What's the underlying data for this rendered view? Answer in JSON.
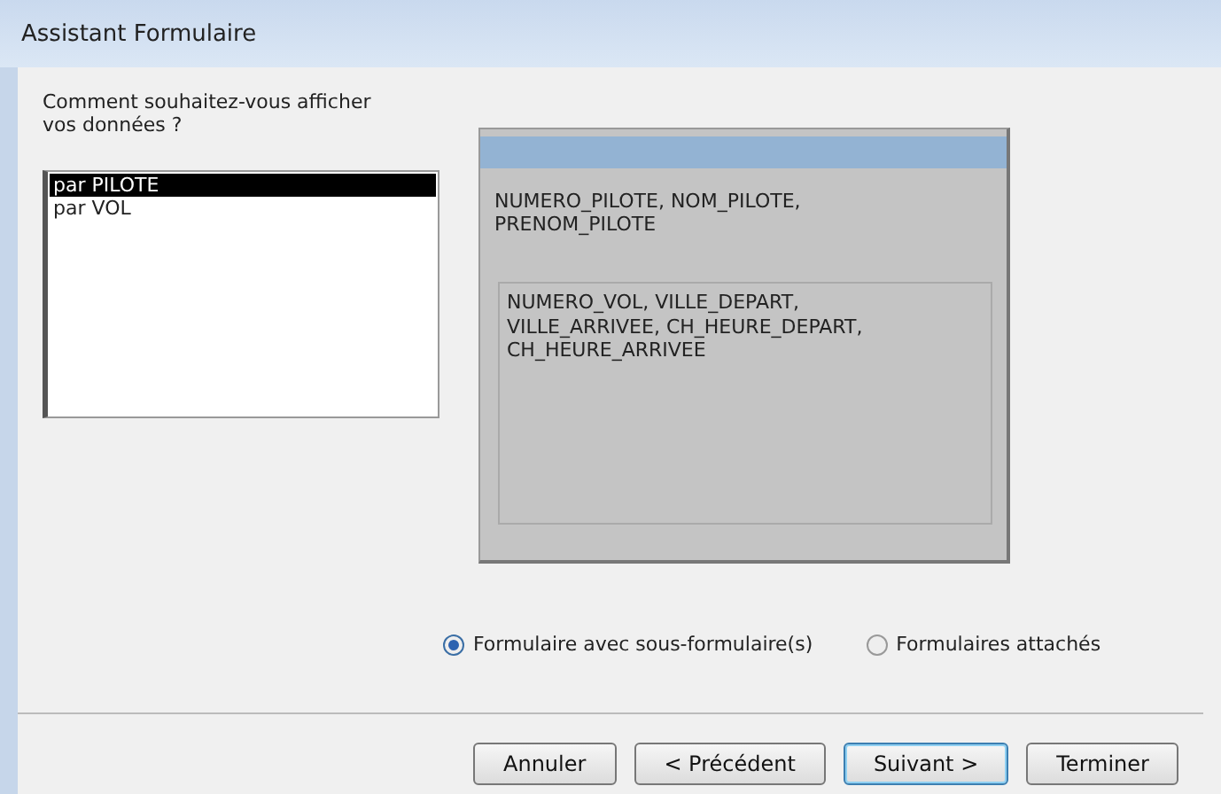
{
  "window": {
    "title": "Assistant Formulaire"
  },
  "prompt": "Comment souhaitez-vous afficher vos données ?",
  "views": [
    {
      "label": "par PILOTE",
      "selected": true
    },
    {
      "label": "par VOL",
      "selected": false
    }
  ],
  "preview": {
    "main_fields": "NUMERO_PILOTE, NOM_PILOTE, PRENOM_PILOTE",
    "sub_fields": "NUMERO_VOL, VILLE_DEPART, VILLE_ARRIVEE, CH_HEURE_DEPART, CH_HEURE_ARRIVEE"
  },
  "options": [
    {
      "label": "Formulaire avec sous-formulaire(s)",
      "selected": true
    },
    {
      "label": "Formulaires attachés",
      "selected": false
    }
  ],
  "buttons": [
    {
      "label": "Annuler",
      "default": false
    },
    {
      "label": "< Précédent",
      "default": false
    },
    {
      "label": "Suivant >",
      "default": true
    },
    {
      "label": "Terminer",
      "default": false
    }
  ]
}
